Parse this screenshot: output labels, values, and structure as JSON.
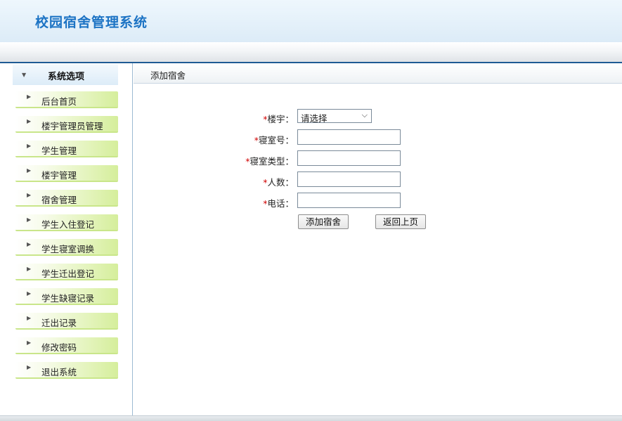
{
  "app": {
    "title": "校园宿舍管理系统"
  },
  "sidebar": {
    "title": "系统选项",
    "items": [
      {
        "label": "后台首页"
      },
      {
        "label": "楼宇管理员管理"
      },
      {
        "label": "学生管理"
      },
      {
        "label": "楼宇管理"
      },
      {
        "label": "宿舍管理"
      },
      {
        "label": "学生入住登记"
      },
      {
        "label": "学生寝室调换"
      },
      {
        "label": "学生迁出登记"
      },
      {
        "label": "学生缺寝记录"
      },
      {
        "label": "迁出记录"
      },
      {
        "label": "修改密码"
      },
      {
        "label": "退出系统"
      }
    ]
  },
  "main": {
    "title": "添加宿舍",
    "form": {
      "required_mark": "*",
      "building_label": "楼宇：",
      "building_value": "请选择",
      "room_no_label": "寝室号：",
      "room_no_value": "",
      "room_type_label": "寝室类型：",
      "room_type_value": "",
      "capacity_label": "人数：",
      "capacity_value": "",
      "phone_label": "电话：",
      "phone_value": ""
    },
    "buttons": {
      "submit_label": "添加宿舍",
      "back_label": "返回上页"
    }
  }
}
